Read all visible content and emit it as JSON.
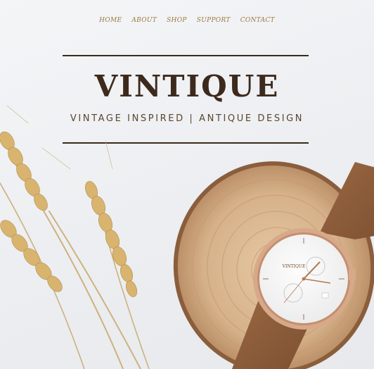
{
  "nav": {
    "items": [
      "HOME",
      "ABOUT",
      "SHOP",
      "SUPPORT",
      "CONTACT"
    ]
  },
  "hero": {
    "brand": "VINTIQUE",
    "tagline": "VINTAGE INSPIRED | ANTIQUE DESIGN"
  },
  "watch_dial": {
    "brand": "VINTIQUE"
  },
  "colors": {
    "nav_text": "#9a7a42",
    "brand_text": "#3d2a1c",
    "rule": "#3a2a1c",
    "strap": "#8a5a37",
    "case_rose_gold": "#d7a98a",
    "wood": "#d9b892"
  }
}
